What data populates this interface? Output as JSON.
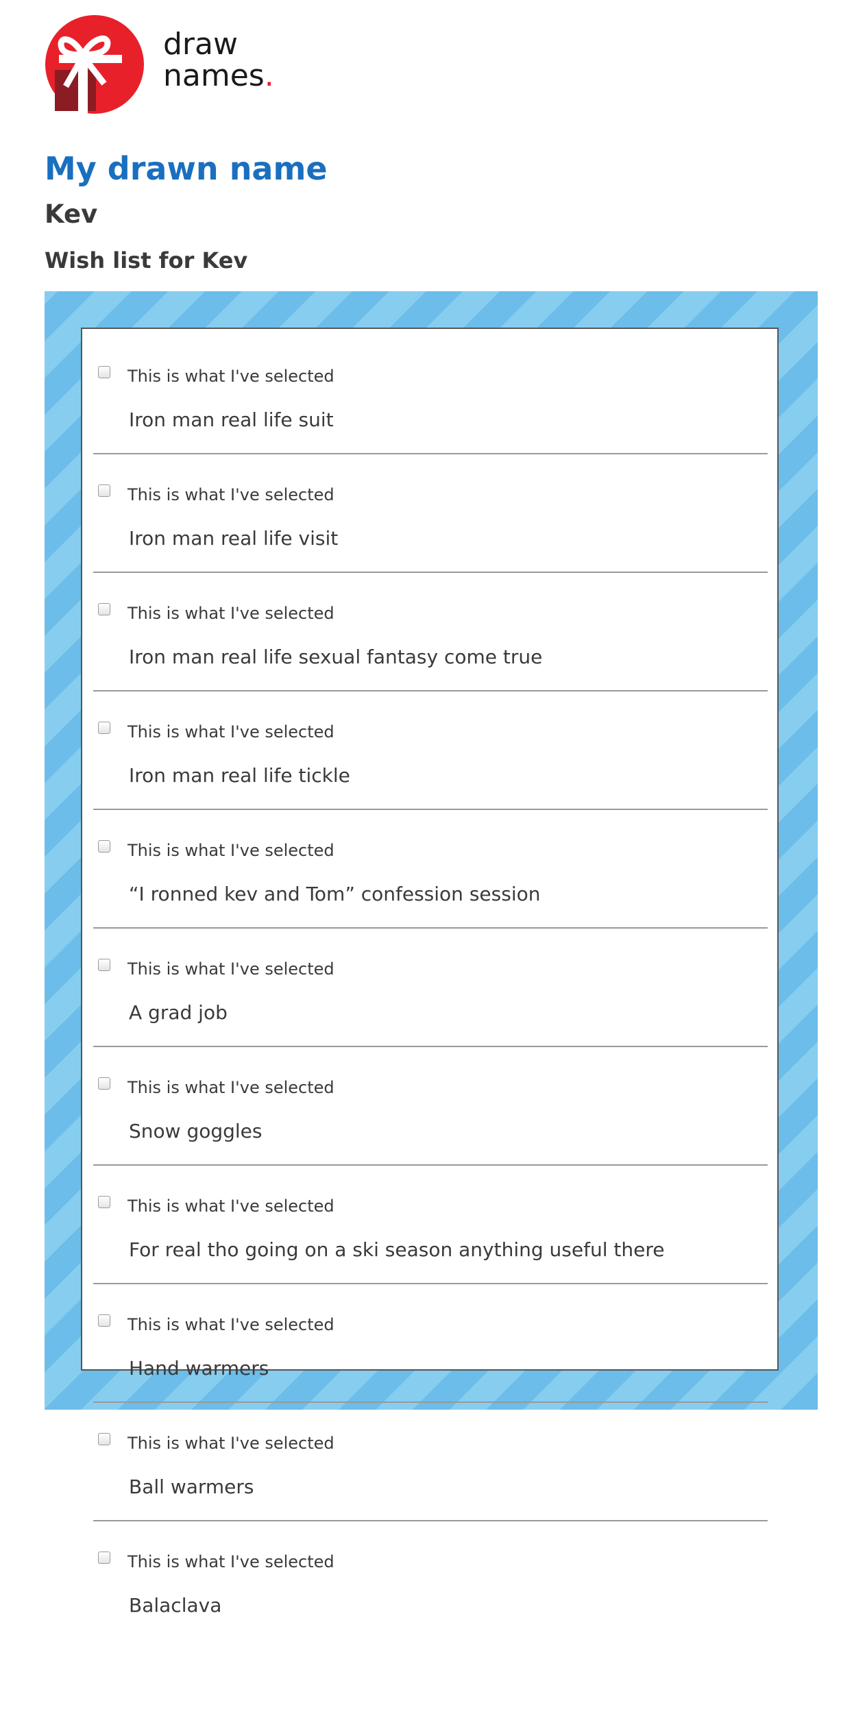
{
  "header": {
    "logo_line1": "draw",
    "logo_line2": "names",
    "logo_dot": ".",
    "brand_color": "#e8202a"
  },
  "page": {
    "title": "My drawn name",
    "drawn_name": "Kev",
    "wishlist_title": "Wish list for Kev"
  },
  "wishlist": {
    "items": [
      {
        "selected_label": "This is what I've selected",
        "text": "Iron man real life suit",
        "checked": false
      },
      {
        "selected_label": "This is what I've selected",
        "text": "Iron man real life visit",
        "checked": false
      },
      {
        "selected_label": "This is what I've selected",
        "text": "Iron man real life sexual fantasy come true",
        "checked": false
      },
      {
        "selected_label": "This is what I've selected",
        "text": "Iron man real life tickle",
        "checked": false
      },
      {
        "selected_label": "This is what I've selected",
        "text": "“I ronned kev and Tom” confession session",
        "checked": false
      },
      {
        "selected_label": "This is what I've selected",
        "text": "A grad job",
        "checked": false
      },
      {
        "selected_label": "This is what I've selected",
        "text": "Snow goggles",
        "checked": false
      },
      {
        "selected_label": "This is what I've selected",
        "text": "For real tho going on a ski season anything useful there",
        "checked": false
      },
      {
        "selected_label": "This is what I've selected",
        "text": "Hand warmers",
        "checked": false
      },
      {
        "selected_label": "This is what I've selected",
        "text": "Ball warmers",
        "checked": false
      },
      {
        "selected_label": "This is what I've selected",
        "text": "Balaclava",
        "checked": false
      }
    ]
  },
  "colors": {
    "title_blue": "#1a6fbf",
    "stripe_light": "#86cdf0",
    "stripe_dark": "#6cbde9"
  }
}
